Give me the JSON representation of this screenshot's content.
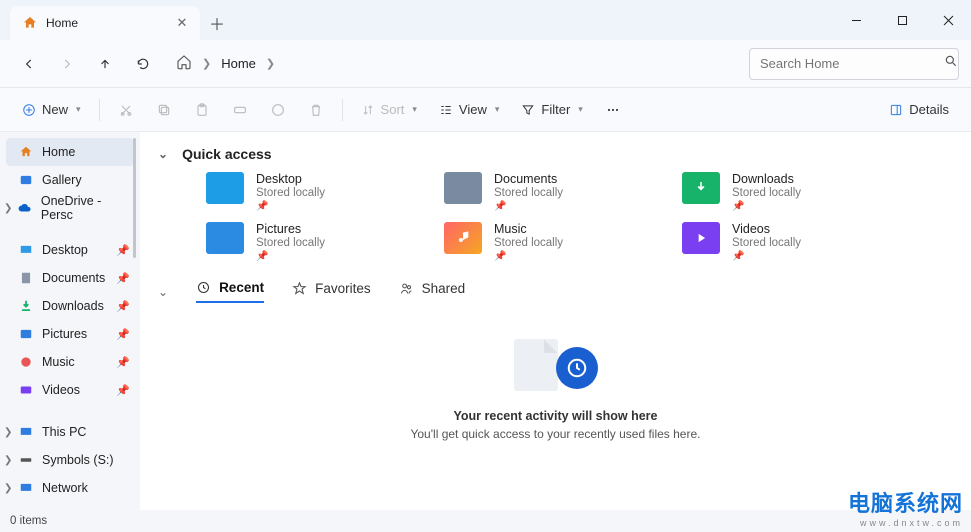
{
  "window": {
    "tab_title": "Home"
  },
  "addressbar": {
    "home_label": "Home",
    "search_placeholder": "Search Home"
  },
  "toolbar": {
    "new": "New",
    "sort": "Sort",
    "view": "View",
    "filter": "Filter",
    "details": "Details"
  },
  "sidebar": {
    "items": [
      {
        "label": "Home"
      },
      {
        "label": "Gallery"
      },
      {
        "label": "OneDrive - Persc"
      },
      {
        "label": "Desktop"
      },
      {
        "label": "Documents"
      },
      {
        "label": "Downloads"
      },
      {
        "label": "Pictures"
      },
      {
        "label": "Music"
      },
      {
        "label": "Videos"
      },
      {
        "label": "This PC"
      },
      {
        "label": "Symbols (S:)"
      },
      {
        "label": "Network"
      }
    ]
  },
  "quick_access": {
    "title": "Quick access",
    "items": [
      {
        "name": "Desktop",
        "sub": "Stored locally"
      },
      {
        "name": "Documents",
        "sub": "Stored locally"
      },
      {
        "name": "Downloads",
        "sub": "Stored locally"
      },
      {
        "name": "Pictures",
        "sub": "Stored locally"
      },
      {
        "name": "Music",
        "sub": "Stored locally"
      },
      {
        "name": "Videos",
        "sub": "Stored locally"
      }
    ]
  },
  "tabs": {
    "recent": "Recent",
    "favorites": "Favorites",
    "shared": "Shared"
  },
  "empty": {
    "title": "Your recent activity will show here",
    "sub": "You'll get quick access to your recently used files here."
  },
  "status": {
    "items": "0 items"
  },
  "watermark": {
    "big": "电脑系统网",
    "small": "www.dnxtw.com"
  }
}
